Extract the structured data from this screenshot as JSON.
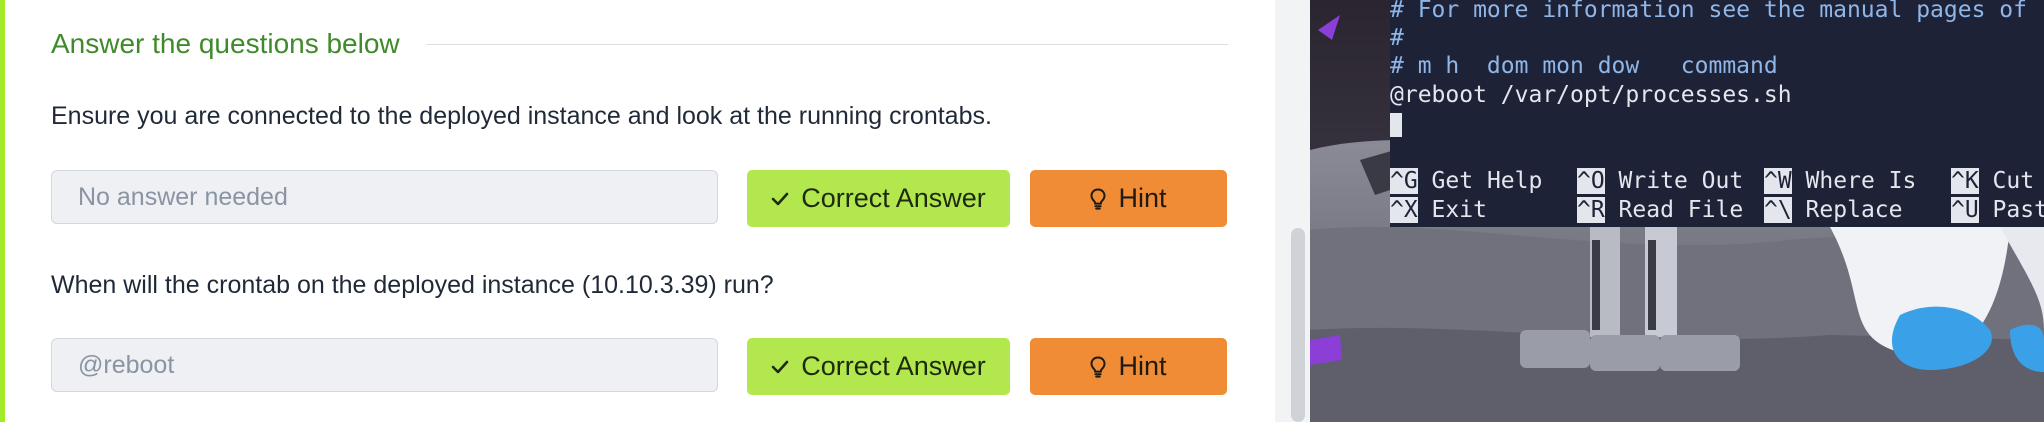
{
  "section": {
    "title": "Answer the questions below"
  },
  "questions": [
    {
      "text": "Ensure you are connected to the deployed instance and look at the running crontabs.",
      "answer_placeholder": "No answer needed",
      "correct_label": "Correct Answer",
      "hint_label": "Hint"
    },
    {
      "text": "When will the crontab on the deployed instance (10.10.3.39) run?",
      "answer_placeholder": "@reboot",
      "correct_label": "Correct Answer",
      "hint_label": "Hint"
    }
  ],
  "terminal": {
    "lines": [
      "# For more information see the manual pages of",
      "#",
      "# m h  dom mon dow   command",
      "@reboot /var/opt/processes.sh"
    ],
    "shortcuts_row1": [
      {
        "key": "^G",
        "label": " Get Help"
      },
      {
        "key": "^O",
        "label": " Write Out"
      },
      {
        "key": "^W",
        "label": " Where Is"
      },
      {
        "key": "^K",
        "label": " Cut"
      }
    ],
    "shortcuts_row2": [
      {
        "key": "^X",
        "label": " Exit"
      },
      {
        "key": "^R",
        "label": " Read File"
      },
      {
        "key": "^\\",
        "label": " Replace"
      },
      {
        "key": "^U",
        "label": " Past"
      }
    ]
  },
  "colors": {
    "accent_green": "#a3ea2a",
    "title_green": "#3f8a2a",
    "correct_button": "#b2e74e",
    "hint_button": "#f08c35",
    "terminal_bg": "#1e2236",
    "terminal_comment": "#8fb6e8"
  },
  "icons": {
    "correct": "check-icon",
    "hint": "lightbulb-icon"
  }
}
